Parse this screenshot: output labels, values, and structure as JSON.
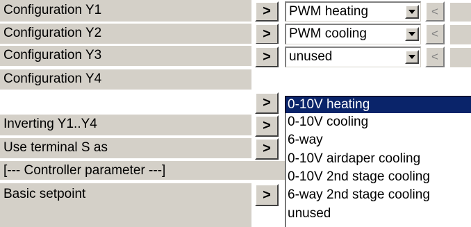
{
  "parameters": [
    {
      "label": "Configuration Y1",
      "value": "PWM heating"
    },
    {
      "label": "Configuration Y2",
      "value": "PWM cooling"
    },
    {
      "label": "Configuration Y3",
      "value": "unused"
    },
    {
      "label": "Configuration Y4"
    },
    {
      "label": "Inverting Y1..Y4"
    },
    {
      "label": "Use terminal S as"
    }
  ],
  "controller_section": "[--- Controller parameter ---]",
  "basic_setpoint": {
    "label": "Basic setpoint"
  },
  "arrow_glyph": ">",
  "prev_glyph": "<",
  "dropdown_options": [
    "0-10V heating",
    "0-10V cooling",
    "6-way",
    "0-10V airdaper cooling",
    "0-10V 2nd stage cooling",
    "6-way 2nd stage cooling",
    "unused"
  ],
  "dropdown_selected_index": 0,
  "colors": {
    "panel": "#d4d0c8",
    "highlight": "#0a246a"
  }
}
